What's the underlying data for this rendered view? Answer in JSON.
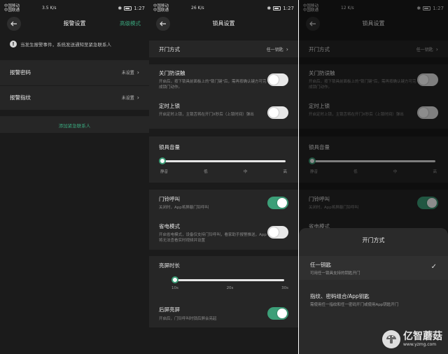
{
  "status": {
    "carrier1": "中国移动 ",
    "carrier2": "中国联通 ",
    "speed1": "3.5 K/s",
    "speed2": "26 K/s",
    "speed3": "12 K/s",
    "time": "1:27"
  },
  "s1": {
    "title": "报警设置",
    "mode": "高级模式",
    "info": "当发生报警事件，系统发送通知至紧急联系人",
    "rows": [
      {
        "label": "报警密码",
        "value": "未设置"
      },
      {
        "label": "报警指纹",
        "value": "未设置"
      }
    ],
    "add": "添加紧急联系人"
  },
  "s2": {
    "title": "锁具设置",
    "open_label": "开门方式",
    "open_value": "任一钥匙",
    "anti_title": "关门防误触",
    "anti_desc": "开启后，按下锁具前面板上的\"锁门键\"后，需再按确认键方可完成锁门动作。",
    "timed_title": "定时上锁",
    "timed_desc": "开启定时上锁，主锁舌将在开门X秒后（上锁时间）弹出",
    "volume_title": "锁具音量",
    "volume_ticks": [
      "静音",
      "低",
      "中",
      "高"
    ],
    "doorbell_title": "门铃呼叫",
    "doorbell_desc": "关闭时，App将屏蔽门铃呼叫",
    "power_title": "省电模式",
    "power_desc": "开启省电模式，设备仅支持门铃呼叫，看家助手报警推送，App将无法查看实时视频并设置",
    "screen_title": "亮屏时长",
    "screen_ticks": [
      "10s",
      "20s",
      "30s"
    ],
    "after_title": "后屏亮屏",
    "after_desc": "开启后，门铃呼叫时锁后屏会亮起"
  },
  "s3": {
    "sheet_title": "开门方式",
    "opt1_title": "任一钥匙",
    "opt1_desc": "可用任一锁具支持的钥匙开门",
    "opt2_title": "指纹、密码组合/App钥匙",
    "opt2_desc": "需使用任一指纹和任一密码开门或使用App钥匙开门",
    "power_title": "省电模式"
  },
  "watermark": {
    "name": "亿智蘑菇",
    "url": "www.yzmg.com"
  },
  "colors": {
    "accent": "#3aa67d",
    "bg": "#1b1b1b",
    "card": "#262626"
  }
}
